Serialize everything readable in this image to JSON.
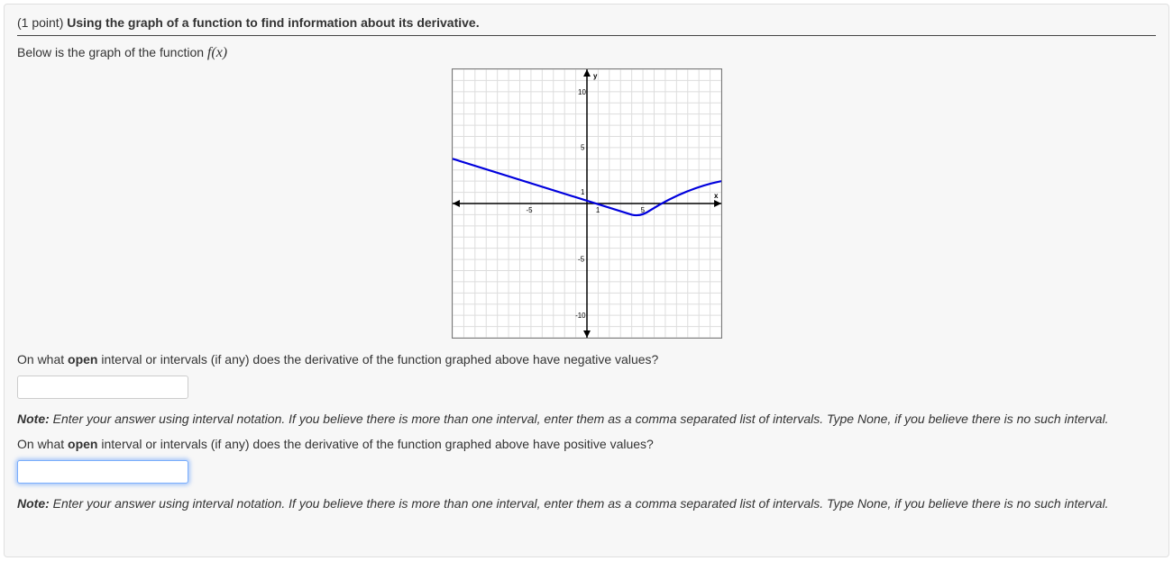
{
  "header": {
    "points": "(1 point)",
    "title": "Using the graph of a function to find information about its derivative."
  },
  "intro": {
    "prefix": "Below is the graph of the function ",
    "fx": "f(x)"
  },
  "chart_data": {
    "type": "line",
    "title": "",
    "xlabel": "x",
    "ylabel": "y",
    "xlim": [
      -12,
      12
    ],
    "ylim": [
      -12,
      12
    ],
    "xticks": [
      -5,
      1,
      5
    ],
    "yticks": [
      -10,
      -5,
      1,
      5,
      10
    ],
    "series": [
      {
        "name": "f(x)",
        "points": [
          {
            "x": -12,
            "y": 4
          },
          {
            "x": 4,
            "y": -1
          },
          {
            "x": 12,
            "y": 2
          }
        ]
      }
    ]
  },
  "q1": {
    "pre": "On what ",
    "bold": "open",
    "post": " interval or intervals (if any) does the derivative of the function graphed above have negative values?"
  },
  "q2": {
    "pre": "On what ",
    "bold": "open",
    "post": " interval or intervals (if any) does the derivative of the function graphed above have positive values?"
  },
  "note": {
    "label": "Note:",
    "text": " Enter your answer using interval notation. If you believe there is more than one interval, enter them as a comma separated list of intervals. Type None, if you believe there is no such interval."
  },
  "inputs": {
    "ans1": "",
    "ans2": ""
  }
}
